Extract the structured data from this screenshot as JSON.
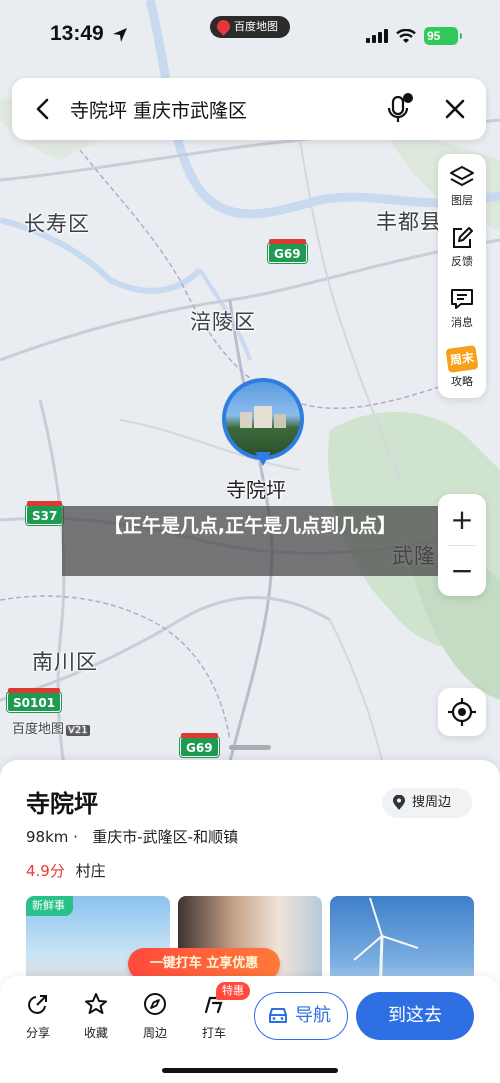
{
  "status_bar": {
    "time": "13:49",
    "battery": "95"
  },
  "app_pill": "百度地图",
  "search": {
    "query": "寺院坪 重庆市武隆区"
  },
  "toolbar": {
    "items": [
      {
        "label": "图层",
        "icon": "layers-icon"
      },
      {
        "label": "反馈",
        "icon": "feedback-edit-icon"
      },
      {
        "label": "消息",
        "icon": "message-icon"
      },
      {
        "label": "攻略",
        "badge": "周末",
        "icon": "weekend-guide-icon"
      }
    ]
  },
  "zoom": {
    "in": "+",
    "out": "−"
  },
  "map": {
    "labels": {
      "changshou": "长寿区",
      "fengdu": "丰都县",
      "fuling": "涪陵区",
      "wulong": "武隆",
      "nanchuan": "南川区"
    },
    "shields": {
      "g69_top": "G69",
      "s37": "S37",
      "s0101": "S0101",
      "g69_bottom": "G69"
    },
    "poi_label": "寺院坪",
    "logo": "百度地图",
    "logo_version": "V21"
  },
  "overlay_banner": "【正午是几点,正午是几点到几点】",
  "sheet": {
    "title": "寺院坪",
    "nearby_label": "搜周边",
    "distance": "98km",
    "region": "重庆市-武隆区-和顺镇",
    "score": "4.9分",
    "category": "村庄",
    "fresh_tag": "新鲜事",
    "taxi_promo": "一键打车 立享优惠"
  },
  "actions": {
    "share": "分享",
    "favorite": "收藏",
    "nearby": "周边",
    "taxi": "打车",
    "special_tag": "特惠",
    "navigate": "导航",
    "go_here": "到这去"
  },
  "colors": {
    "accent": "#2f6fe4",
    "score_red": "#e8393b",
    "highway_green": "#1f9a52",
    "battery_green": "#32c85a"
  }
}
